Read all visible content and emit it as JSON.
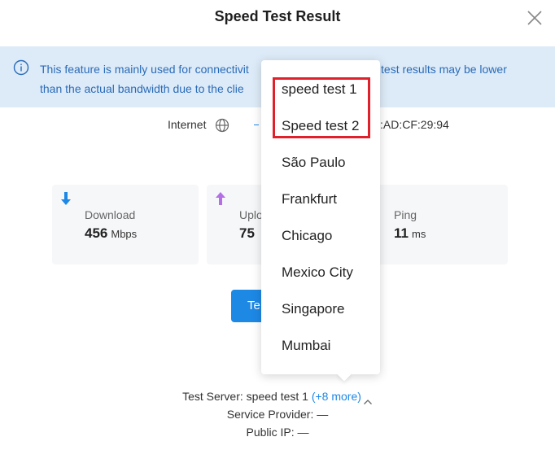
{
  "header": {
    "title": "Speed Test Result"
  },
  "notice": {
    "text_left_line1": "This feature is mainly used for connectivit",
    "text_right_line1": "eed test results may be lower",
    "text_line2": "than the actual bandwidth due to the clie"
  },
  "connection": {
    "label": "Internet",
    "mac_partial": ":AD:CF:29:94"
  },
  "cards": {
    "download": {
      "label": "Download",
      "value": "456",
      "unit": "Mbps"
    },
    "upload": {
      "label": "Uplo",
      "value": "75"
    },
    "ping": {
      "label": "Ping",
      "value": "11",
      "unit": "ms"
    }
  },
  "test_button": {
    "label": "Te"
  },
  "footer": {
    "server_label": "Test Server: speed test 1",
    "more": "(+8 more)",
    "provider": "Service Provider: —",
    "public_ip": "Public IP: —"
  },
  "dropdown": {
    "items": [
      "speed test 1",
      "Speed test 2",
      "São Paulo",
      "Frankfurt",
      "Chicago",
      "Mexico City",
      "Singapore",
      "Mumbai"
    ]
  },
  "colors": {
    "accent": "#1e88e5",
    "notice_bg": "#ddebf8",
    "notice_text": "#2a6bb8",
    "highlight": "#e0202a",
    "upload_arrow": "#b46ee6"
  }
}
